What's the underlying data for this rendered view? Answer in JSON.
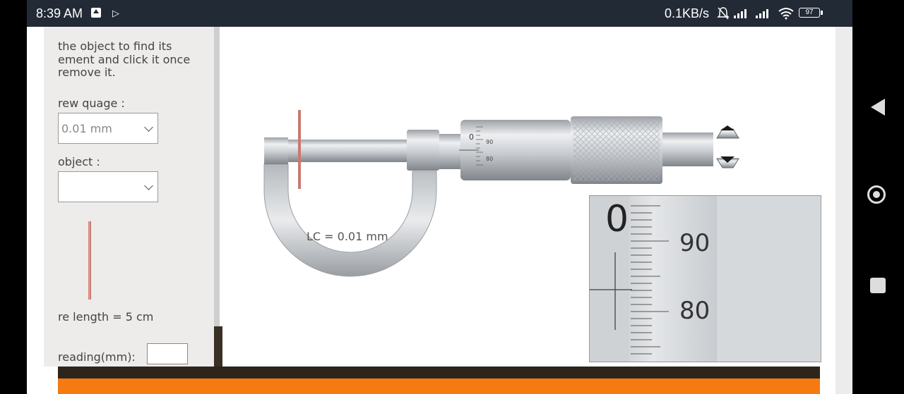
{
  "status_bar": {
    "time": "8:39 AM",
    "network_speed": "0.1KB/s",
    "battery": "97",
    "icons": [
      "upload-icon",
      "play-icon",
      "mute-bell-icon",
      "signal-icon",
      "signal-icon",
      "wifi-icon",
      "battery-icon"
    ]
  },
  "left_panel": {
    "instruction_lines": [
      "the object to find its",
      "ement and click it once",
      "remove it."
    ],
    "screw_gauge_label": "rew quage :",
    "screw_gauge_value": "0.01 mm",
    "object_label": "object :",
    "object_value": "",
    "wire_length_label": "re length = 5 cm",
    "reading_label": "reading(mm):",
    "reading_value": ""
  },
  "simulation": {
    "least_count_label": "LC = 0.01 mm",
    "thimble_scale_labels": [
      "90",
      "80"
    ],
    "zoom_main_scale_zero": "0",
    "zoom_thimble_labels": [
      "90",
      "80"
    ],
    "small_thimble_labels": [
      "0",
      "90",
      "80"
    ]
  },
  "nav_bar": {
    "icons": [
      "back-icon",
      "home-icon",
      "recents-icon"
    ]
  }
}
